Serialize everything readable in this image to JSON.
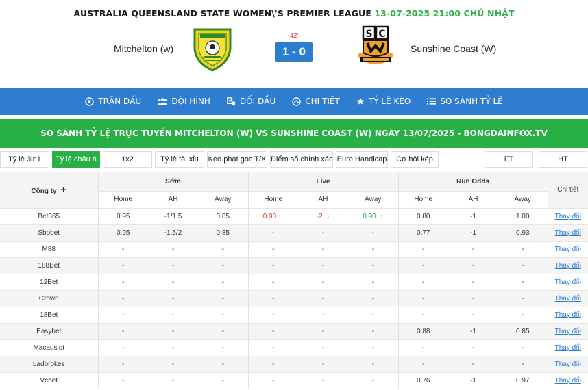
{
  "header": {
    "league": "AUSTRALIA QUEENSLAND STATE WOMEN\\'S PREMIER LEAGUE",
    "datetime": "13-07-2025 21:00 CHỦ NHẬT",
    "home_team": "Mitchelton (w)",
    "away_team": "Sunshine Coast (W)",
    "minute": "42'",
    "score": "1 - 0"
  },
  "nav": [
    {
      "label": "TRẬN ĐẤU",
      "icon": "soccer-ball-icon"
    },
    {
      "label": "ĐỘI HÌNH",
      "icon": "team-icon"
    },
    {
      "label": "ĐỐI ĐẦU",
      "icon": "head-to-head-icon"
    },
    {
      "label": "CHI TIẾT",
      "icon": "details-icon"
    },
    {
      "label": "TỶ LỆ KÈO",
      "icon": "star-icon"
    },
    {
      "label": "SO SÁNH TỶ LỆ",
      "icon": "list-icon"
    }
  ],
  "banner": "SO SÁNH TỶ LỆ TRỰC TUYẾN MITCHELTON (W) VS SUNSHINE COAST (W) NGÀY 13/07/2025 - BONGDAINFOX.TV",
  "tabs": [
    "Tỷ lệ 3in1",
    "Tỷ lệ châu á",
    "1x2",
    "Tỷ lệ tài xỉu",
    "Kèo phạt góc T/X",
    "Điểm số chính xác",
    "Euro Handicap",
    "Cơ hội kép",
    "FT",
    "HT"
  ],
  "table": {
    "company_header": "Công ty",
    "groups": [
      "Sớm",
      "Live",
      "Run Odds"
    ],
    "detail_header": "Chi tiết",
    "sub_headers": [
      "Home",
      "AH",
      "Away",
      "Home",
      "AH",
      "Away",
      "Home",
      "AH",
      "Away"
    ],
    "detail_link": "Thay đổi",
    "rows": [
      {
        "company": "Bet365",
        "cells": [
          "0.95",
          "-1/1.5",
          "0.85",
          "0.90",
          "-2",
          "0.90",
          "0.80",
          "-1",
          "1.00"
        ]
      },
      {
        "company": "Sbobet",
        "cells": [
          "0.95",
          "-1.5/2",
          "0.85",
          "-",
          "-",
          "-",
          "0.77",
          "-1",
          "0.93"
        ]
      },
      {
        "company": "M88",
        "cells": [
          "-",
          "-",
          "-",
          "-",
          "-",
          "-",
          "-",
          "-",
          "-"
        ]
      },
      {
        "company": "188Bet",
        "cells": [
          "-",
          "-",
          "-",
          "-",
          "-",
          "-",
          "-",
          "-",
          "-"
        ]
      },
      {
        "company": "12Bet",
        "cells": [
          "-",
          "-",
          "-",
          "-",
          "-",
          "-",
          "-",
          "-",
          "-"
        ]
      },
      {
        "company": "Crown",
        "cells": [
          "-",
          "-",
          "-",
          "-",
          "-",
          "-",
          "-",
          "-",
          "-"
        ]
      },
      {
        "company": "18Bet",
        "cells": [
          "-",
          "-",
          "-",
          "-",
          "-",
          "-",
          "-",
          "-",
          "-"
        ]
      },
      {
        "company": "Easybet",
        "cells": [
          "-",
          "-",
          "-",
          "-",
          "-",
          "-",
          "0.88",
          "-1",
          "0.85"
        ]
      },
      {
        "company": "Macauslot",
        "cells": [
          "-",
          "-",
          "-",
          "-",
          "-",
          "-",
          "-",
          "-",
          "-"
        ]
      },
      {
        "company": "Ladbrokes",
        "cells": [
          "-",
          "-",
          "-",
          "-",
          "-",
          "-",
          "-",
          "-",
          "-"
        ]
      },
      {
        "company": "Vcbet",
        "cells": [
          "-",
          "-",
          "-",
          "-",
          "-",
          "-",
          "0.76",
          "-1",
          "0.97"
        ]
      }
    ]
  }
}
